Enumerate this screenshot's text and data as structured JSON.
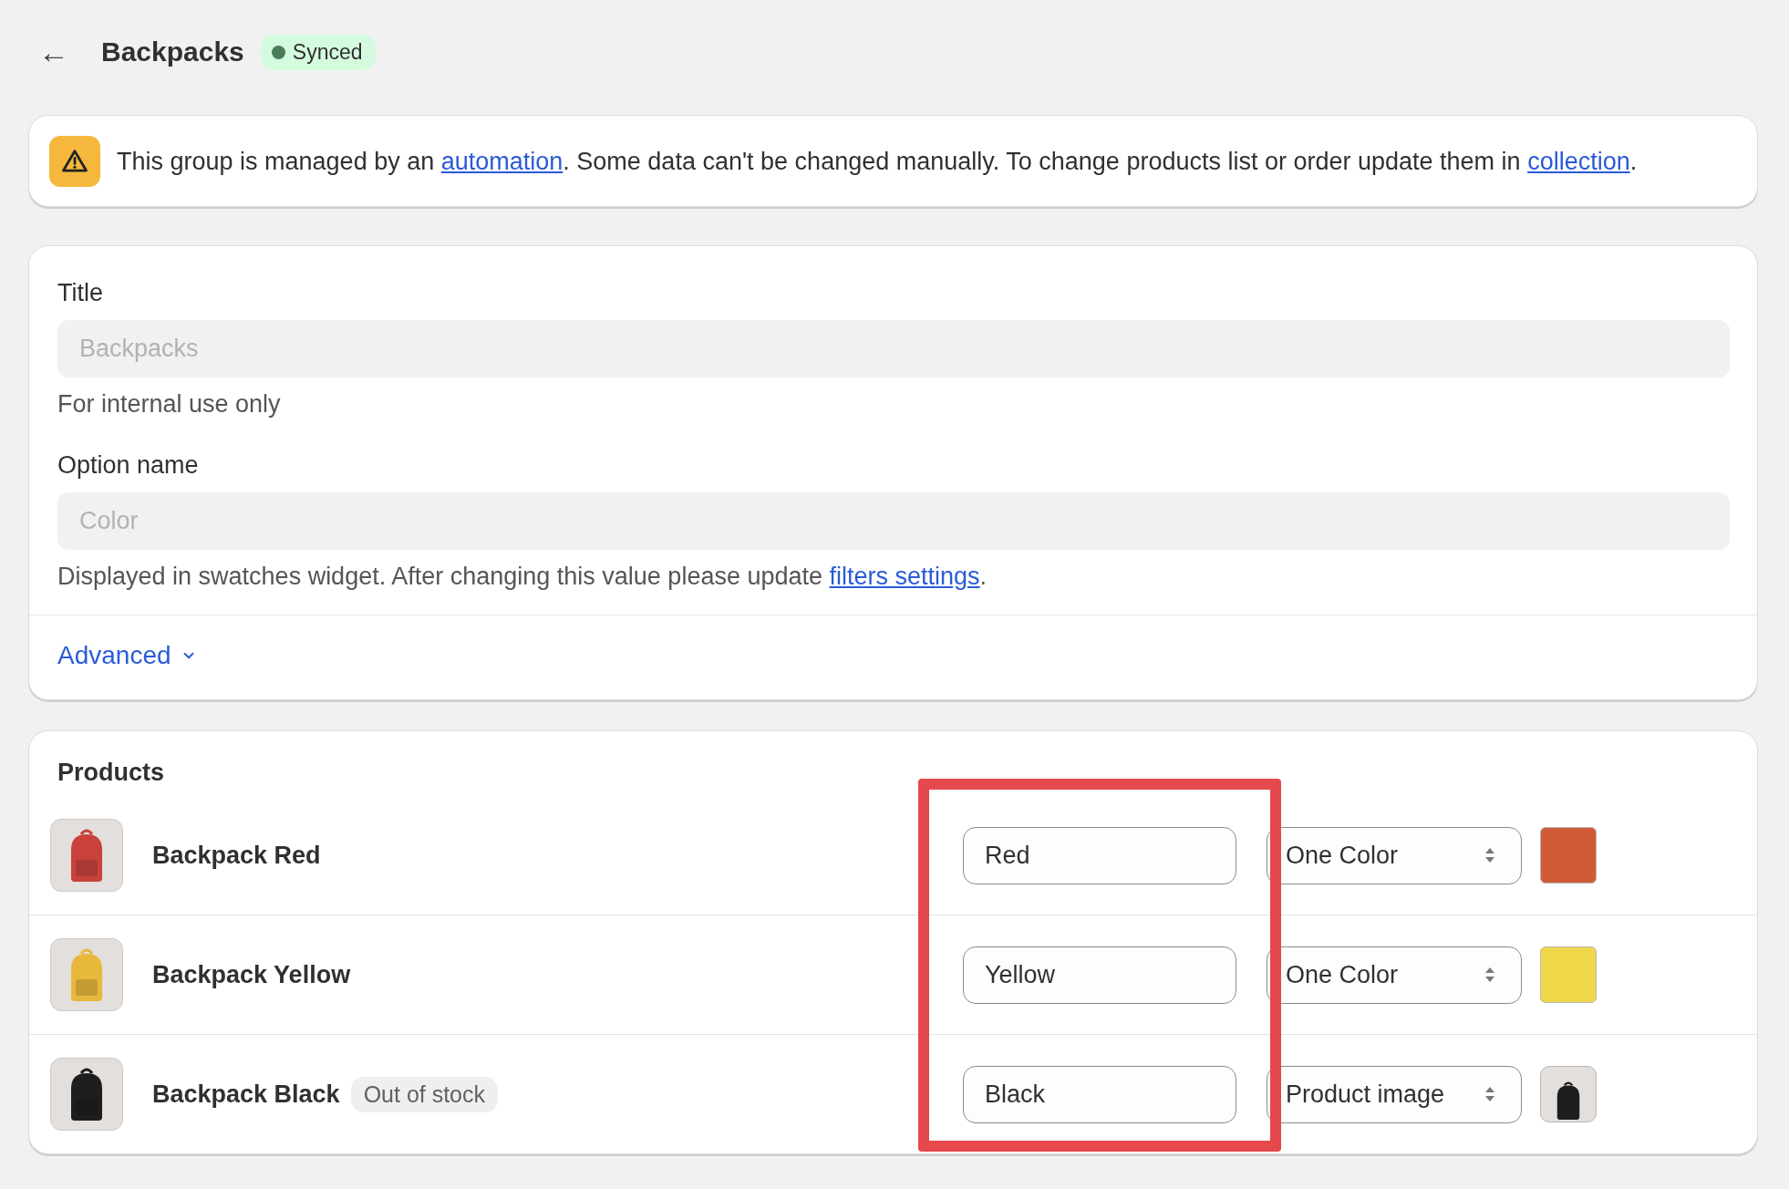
{
  "header": {
    "back": "←",
    "title": "Backpacks",
    "status": {
      "label": "Synced",
      "color": "#4a7c59"
    }
  },
  "banner": {
    "parts": [
      {
        "kind": "text",
        "text": "This group is managed by an "
      },
      {
        "kind": "link",
        "text": "automation"
      },
      {
        "kind": "text",
        "text": ". Some data can't be changed manually. To change products list or order update them in "
      },
      {
        "kind": "link",
        "text": "collection"
      },
      {
        "kind": "text",
        "text": "."
      }
    ]
  },
  "form": {
    "fields": [
      {
        "label": "Title",
        "placeholder": "Backpacks",
        "help": [
          {
            "kind": "text",
            "text": "For internal use only"
          }
        ]
      },
      {
        "label": "Option name",
        "placeholder": "Color",
        "help": [
          {
            "kind": "text",
            "text": "Displayed in swatches widget. After changing this value please update "
          },
          {
            "kind": "link",
            "text": "filters settings"
          },
          {
            "kind": "text",
            "text": "."
          }
        ]
      }
    ],
    "advanced": {
      "label": "Advanced",
      "expanded": false
    }
  },
  "products": {
    "heading": "Products",
    "rows": [
      {
        "name": "Backpack Red",
        "color": "#c8413c",
        "value": "Red",
        "display": "One Color",
        "swatch": {
          "kind": "color",
          "color": "#d05b37"
        }
      },
      {
        "name": "Backpack Yellow",
        "color": "#e8b83c",
        "value": "Yellow",
        "display": "One Color",
        "swatch": {
          "kind": "color",
          "color": "#eed84a"
        }
      },
      {
        "name": "Backpack Black",
        "color": "#1e1e1e",
        "badge": "Out of stock",
        "value": "Black",
        "display": "Product image",
        "swatch": {
          "kind": "image",
          "color": "#1e1e1e"
        }
      }
    ]
  }
}
